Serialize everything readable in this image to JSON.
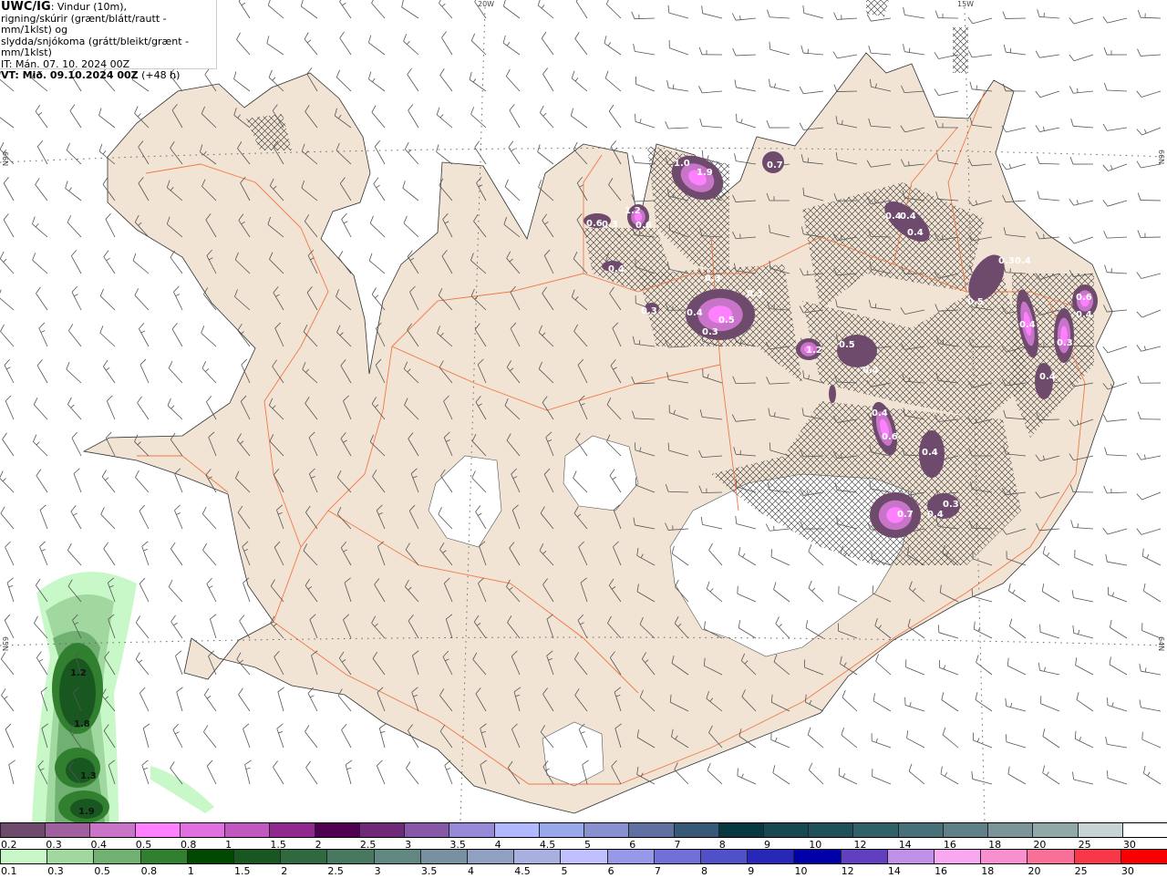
{
  "header": {
    "model": "UWC/IG",
    "description_line1": ": Vindur (10m),",
    "description_line2": "rigning/skúrir (grænt/blátt/rautt - mm/1klst) og",
    "description_line3": "slydda/snjókoma (grátt/bleikt/grænt - mm/1klst)",
    "issue_time": "IT: Mán. 07. 10. 2024 00Z",
    "valid_time_label": "VT: Mið. 09.10.2024 00Z",
    "lead_time": "(+48 h)"
  },
  "map": {
    "region": "Iceland",
    "land_color": "#f2e4d4",
    "sea_color": "#ffffff",
    "glacier_color": "#ffffff",
    "road_color": "#f07848",
    "graticule_labels": {
      "lon_20w": "20W",
      "lon_15w": "15W",
      "lat_66n_left": "66N",
      "lat_66n_right": "66N",
      "lat_65n_left": "65N",
      "lat_64n_right": "64N"
    },
    "snow_labels": [
      "1.0",
      "1.9",
      "0.7",
      "1.2",
      "0.6",
      "0.3",
      "0.6",
      "0.4",
      "0.3",
      "0.3",
      "0.4",
      "0.5",
      "0.3",
      "0.3",
      "0.4",
      "0.4",
      "0.4",
      "0.5",
      "0.3",
      "0.4",
      "0.4",
      "0.3",
      "0.4",
      "0.6",
      "0.4",
      "1.2",
      "0.5",
      "0.4",
      "0.4",
      "0.6",
      "0.4",
      "0.7",
      "0.4",
      "0.3"
    ],
    "rain_labels": [
      "1.2",
      "1.8",
      "1.3",
      "1.9"
    ]
  },
  "legend": {
    "snow_scale": {
      "labels": [
        "0.2",
        "0.3",
        "0.4",
        "0.5",
        "0.8",
        "1",
        "1.5",
        "2",
        "2.5",
        "3",
        "3.5",
        "4",
        "4.5",
        "5",
        "6",
        "7",
        "8",
        "9",
        "10",
        "12",
        "14",
        "16",
        "18",
        "20",
        "25",
        "30"
      ],
      "colors": [
        "#6e4a6c",
        "#a060a0",
        "#c874c8",
        "#ff80ff",
        "#e070e0",
        "#c058c0",
        "#902890",
        "#500050",
        "#702878",
        "#8858a8",
        "#9888d8",
        "#b0b8ff",
        "#98a8e8",
        "#8890d0",
        "#6070a0",
        "#385878",
        "#083840",
        "#184850",
        "#205058",
        "#306068",
        "#487078",
        "#608088",
        "#7a9498",
        "#90a8a8",
        "#c8d4d4",
        "#ffffff"
      ]
    },
    "rain_scale": {
      "labels": [
        "0.1",
        "0.3",
        "0.5",
        "0.8",
        "1",
        "1.5",
        "2",
        "2.5",
        "3",
        "3.5",
        "4",
        "4.5",
        "5",
        "6",
        "7",
        "8",
        "9",
        "10",
        "12",
        "14",
        "16",
        "18",
        "20",
        "25",
        "30"
      ],
      "colors": [
        "#c8f8c8",
        "#a0d8a0",
        "#70b070",
        "#308030",
        "#004800",
        "#185820",
        "#306840",
        "#487860",
        "#608880",
        "#7890a0",
        "#90a0c0",
        "#a8b0e0",
        "#c0c0ff",
        "#9898e8",
        "#7070d8",
        "#5050c8",
        "#2828b8",
        "#0000a8",
        "#6040c0",
        "#c090e8",
        "#f8a8f0",
        "#f890d0",
        "#f87098",
        "#f83848",
        "#f80000"
      ]
    }
  }
}
